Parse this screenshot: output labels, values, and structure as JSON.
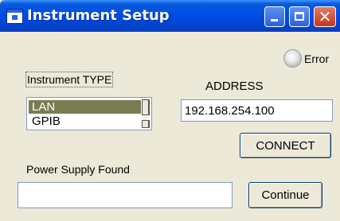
{
  "window": {
    "title": "Instrument Setup",
    "titlebar_color": "#0050e5",
    "icon": "app-window-icon",
    "controls": [
      "minimize-icon",
      "maximize-icon",
      "close-icon"
    ]
  },
  "status": {
    "label": "Error",
    "state": "off"
  },
  "instrument_type": {
    "label": "Instrument TYPE",
    "options": [
      "LAN",
      "GPIB"
    ],
    "selected": "LAN",
    "selection_color": "#7b7b50"
  },
  "address": {
    "label": "ADDRESS",
    "value": "192.168.254.100"
  },
  "connect_button": {
    "label": "CONNECT"
  },
  "found": {
    "label": "Power Supply  Found",
    "value": ""
  },
  "continue_button": {
    "label": "Continue"
  }
}
